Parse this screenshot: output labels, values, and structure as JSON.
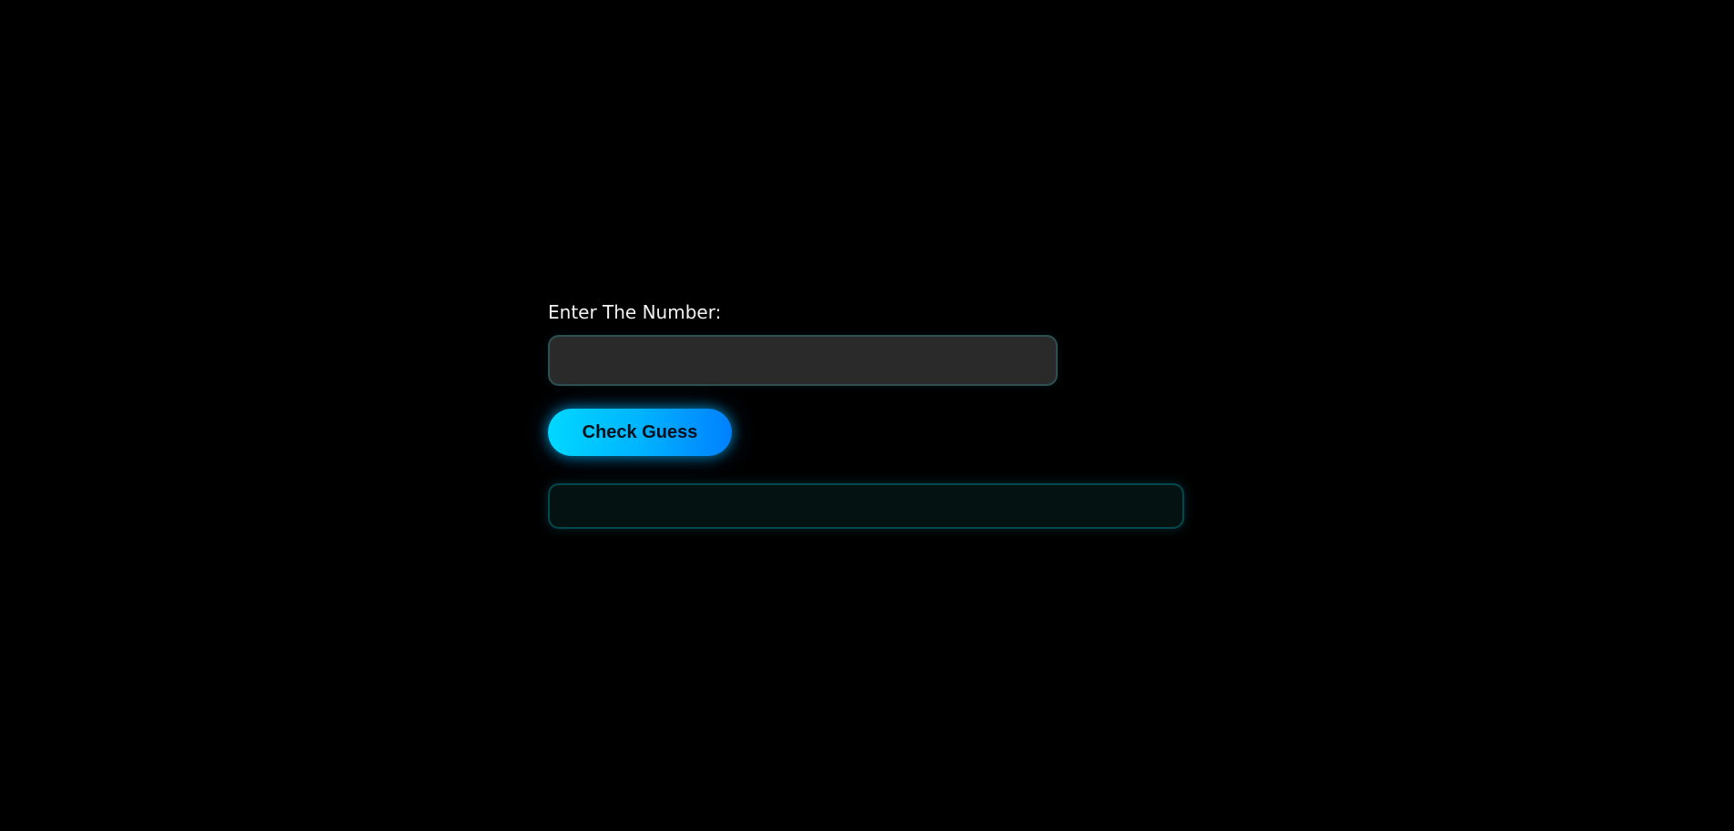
{
  "form": {
    "label": "Enter The Number:",
    "input_value": "",
    "button_label": "Check Guess",
    "message": ""
  },
  "colors": {
    "background": "#000000",
    "accent_start": "#00d8ff",
    "accent_end": "#0080ff",
    "input_background": "#2a2a2a",
    "message_background": "#041212"
  }
}
